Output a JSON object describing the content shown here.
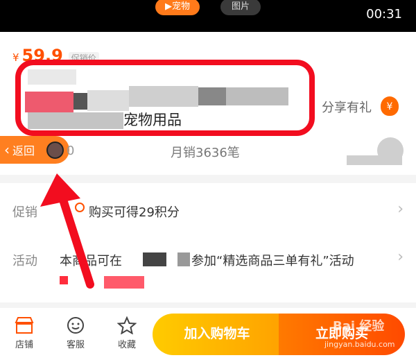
{
  "topbar": {
    "tab_pet": "▶宠物",
    "tab_images": "图片",
    "time": "00:31"
  },
  "price": {
    "symbol": "¥",
    "value": "59.9",
    "tag": "促销价"
  },
  "product": {
    "title_tail": "宠物用品"
  },
  "share": {
    "label": "分享有礼",
    "icon": "red-envelope-icon"
  },
  "back": {
    "label": "返回",
    "chevron": "‹"
  },
  "stats": {
    "zero": "0",
    "monthly_sales": "月销3636笔"
  },
  "promo": {
    "label": "促销",
    "text": "购买可得29积分",
    "arrow": "›"
  },
  "activity": {
    "label": "活动",
    "text_prefix": "本商品可在",
    "text_suffix": "参加“精选商品三单有礼”活动",
    "arrow": "›"
  },
  "bottom": {
    "store": "店铺",
    "service": "客服",
    "favorite": "收藏",
    "add_cart": "加入购物车",
    "buy_now": "立即购买"
  },
  "watermark": {
    "logo": "Bai 经验",
    "site": "jingyan.baidu.com"
  },
  "colors": {
    "accent": "#ff5000",
    "highlight": "#f20d1f",
    "cart": "#ffb300",
    "buy": "#ff5a00"
  }
}
